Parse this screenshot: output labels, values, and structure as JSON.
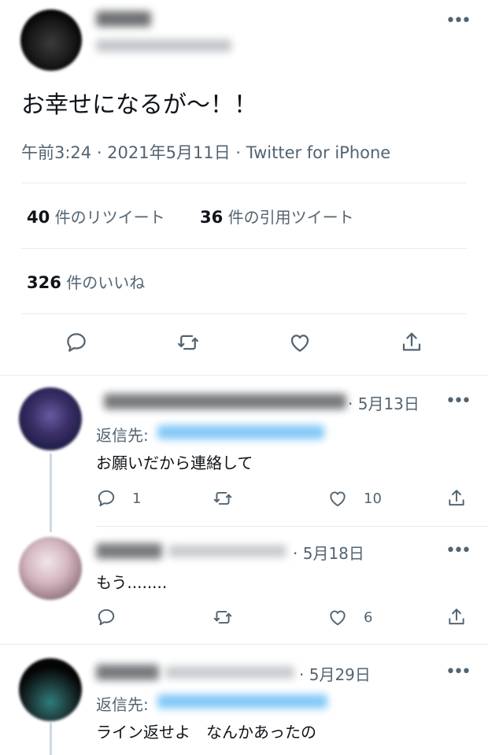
{
  "main_tweet": {
    "text": "お幸せになるが〜！！",
    "meta": "午前3:24 · 2021年5月11日 · Twitter for iPhone",
    "retweets_count": "40",
    "retweets_label": "件のリツイート",
    "quotes_count": "36",
    "quotes_label": "件の引用ツイート",
    "likes_count": "326",
    "likes_label": "件のいいね",
    "more_icon": "•••"
  },
  "replies": [
    {
      "date": "· 5月13日",
      "replying_label": "返信先:",
      "text": "お願いだから連絡して",
      "reply_count": "1",
      "like_count": "10",
      "more_icon": "•••"
    },
    {
      "date": "· 5月18日",
      "text": "もう........",
      "like_count": "6",
      "more_icon": "•••"
    },
    {
      "date": "· 5月29日",
      "replying_label": "返信先:",
      "text": "ライン返せよ　なんかあったの",
      "more_icon": "•••"
    }
  ],
  "icons": {
    "reply": "reply-icon",
    "retweet": "retweet-icon",
    "like": "heart-icon",
    "share": "share-icon",
    "more": "more-icon"
  },
  "colors": {
    "text": "#0f1419",
    "secondary": "#536471",
    "divider": "#e6ecf0",
    "link": "#1d9bf0"
  }
}
